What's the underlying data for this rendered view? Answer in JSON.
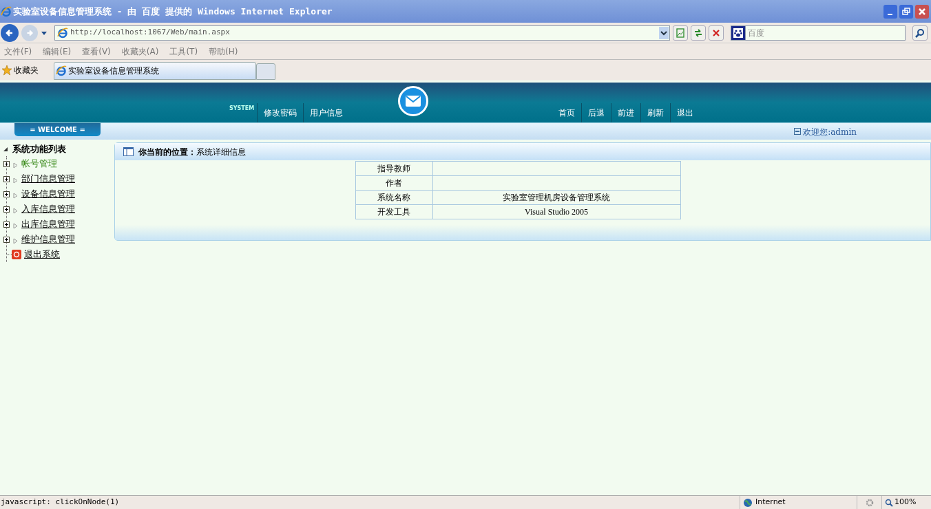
{
  "window": {
    "title": "实验室设备信息管理系统 - 由 百度 提供的 Windows Internet Explorer"
  },
  "address_bar": {
    "url": "http://localhost:1067/Web/main.aspx"
  },
  "search_box": {
    "placeholder": "百度"
  },
  "menu_bar": [
    "文件(F)",
    "编辑(E)",
    "查看(V)",
    "收藏夹(A)",
    "工具(T)",
    "帮助(H)"
  ],
  "favorites": {
    "label": "收藏夹"
  },
  "tabs": [
    {
      "label": "实验室设备信息管理系统",
      "selected": true
    }
  ],
  "header": {
    "system_label": "SYSTEM",
    "left_links": [
      "修改密码",
      "用户信息"
    ],
    "right_links": [
      "首页",
      "后退",
      "前进",
      "刷新",
      "退出"
    ]
  },
  "welcome_bar": {
    "badge": "= WELCOME =",
    "greeting": "欢迎您:admin"
  },
  "sidebar": {
    "title": "系统功能列表",
    "items": [
      {
        "label": "帐号管理",
        "kind": "folder",
        "hovered": true
      },
      {
        "label": "部门信息管理",
        "kind": "folder",
        "hovered": false
      },
      {
        "label": "设备信息管理",
        "kind": "folder",
        "hovered": false
      },
      {
        "label": "入库信息管理",
        "kind": "folder",
        "hovered": false
      },
      {
        "label": "出库信息管理",
        "kind": "folder",
        "hovered": false
      },
      {
        "label": "维护信息管理",
        "kind": "folder",
        "hovered": false
      },
      {
        "label": "退出系统",
        "kind": "exit",
        "hovered": false
      }
    ]
  },
  "panel": {
    "breadcrumb": "**你当前的位置：**系统详细信息",
    "rows": [
      {
        "label": "指导教师"
      },
      {
        "label": "作者"
      },
      {
        "label": "系统名称",
        "value": "实验室管理机房设备管理系统"
      },
      {
        "label": "开发工具",
        "value": "Visual Studio 2005"
      }
    ]
  },
  "status_bar": {
    "text": "javascript: clickOnNode(1)",
    "zone": "Internet",
    "zoom": "100%"
  }
}
